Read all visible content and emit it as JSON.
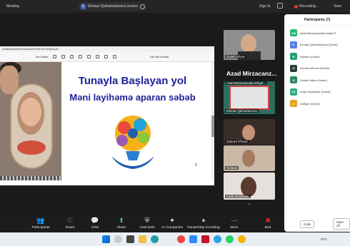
{
  "topbar": {
    "meeting": "Meeting",
    "share_tab": "Elmnaz Qahramanova's screen",
    "share_icon": "E",
    "signin": "Sign In",
    "recording": "Recording...",
    "view": "View"
  },
  "share": {
    "url": "/Desktop/Azad%20Sahadov%20Form%20pdf.pdf",
    "toolbar_label": "Ara Dialect",
    "ask_label": "Edit with Acrobat",
    "slide_title1": "Tunayla  Başlayan yol",
    "slide_title2": "Məni layihəmə aparan səbəb",
    "page_number": "2"
  },
  "video": {
    "tile1_name": "Gusein Aliyev",
    "big_name": "Azad Mirzacanz...",
    "tile2_name": "Azad Mirzacanzada Inkişaf...",
    "tile3_name": "Elmnaz Qahramanova",
    "tile4_name": "Zarina's iPhone",
    "tile5_name": "Nurlana",
    "tile6_name": "Leyla Seyidzade"
  },
  "participants": {
    "title": "Participants (7)",
    "list": [
      {
        "initials": "AM",
        "name": "Azad Mirzacanzada Inkişaf P...",
        "color": "#2bb673"
      },
      {
        "initials": "E",
        "name": "Elmnaz Qahramanova (Guest)",
        "color": "#5b7ee5"
      },
      {
        "initials": "N",
        "name": "Nurlana (Guest)",
        "color": "#2b9e77"
      },
      {
        "initials": "ZI",
        "name": "Zarina's iPhone (Guest)",
        "color": "#2d3e3a"
      },
      {
        "initials": "G",
        "name": "Gusein Aliyev (Guest)",
        "color": "#2e8a5f"
      },
      {
        "initials": "LS",
        "name": "Leyla Seyidzade (Guest)",
        "color": "#2fae84"
      },
      {
        "initials": "Z",
        "name": "Zulfiyye (Guest)",
        "color": "#e8a21f"
      }
    ],
    "invite": "Invite",
    "mute_all": "Mute all"
  },
  "toolbar": {
    "participants": "Participants",
    "participants_count": "7",
    "react": "React",
    "chat": "Chat",
    "share": "Share",
    "host_tools": "Host tools",
    "ai": "AI Companion",
    "pause": "Pause/stop recording",
    "more": "More",
    "end": "End"
  },
  "taskbar": {
    "lang": "РУС"
  }
}
